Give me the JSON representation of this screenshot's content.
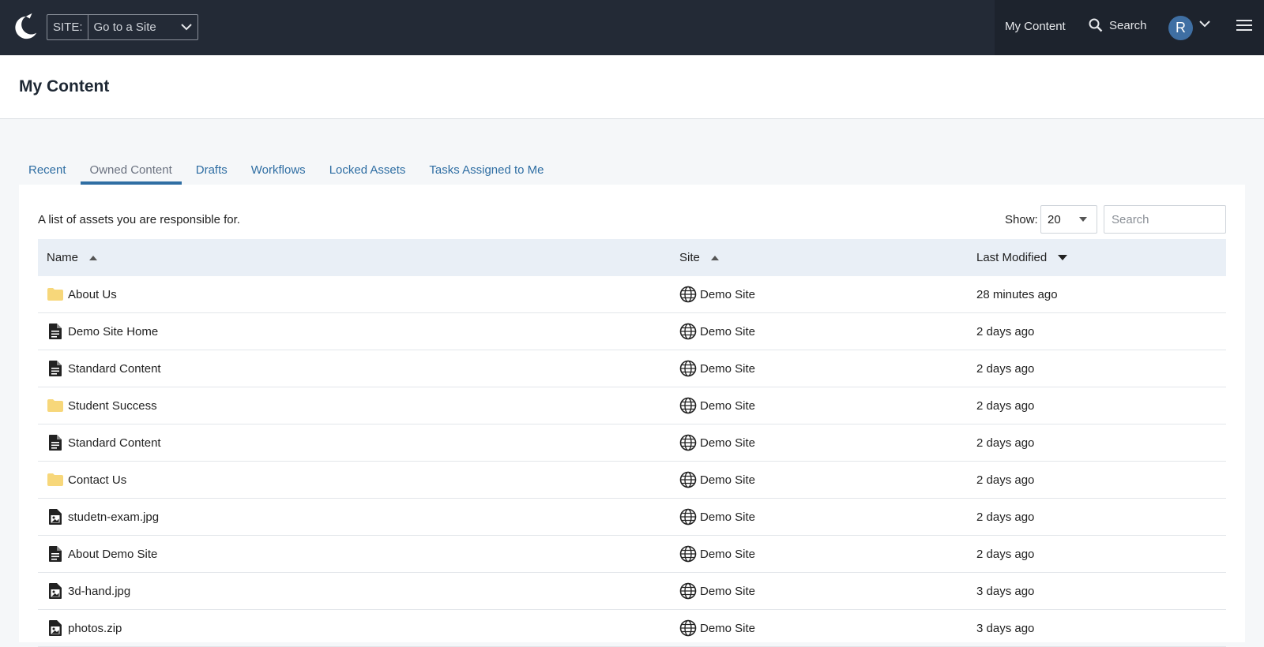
{
  "topbar": {
    "site_label": "SITE:",
    "site_value": "Go to a Site",
    "my_content": "My Content",
    "search": "Search",
    "avatar_initial": "R"
  },
  "page": {
    "title": "My Content"
  },
  "tabs": [
    {
      "label": "Recent",
      "active": false
    },
    {
      "label": "Owned Content",
      "active": true
    },
    {
      "label": "Drafts",
      "active": false
    },
    {
      "label": "Workflows",
      "active": false
    },
    {
      "label": "Locked Assets",
      "active": false
    },
    {
      "label": "Tasks Assigned to Me",
      "active": false
    }
  ],
  "panel": {
    "description": "A list of assets you are responsible for.",
    "show_label": "Show:",
    "show_value": "20",
    "search_placeholder": "Search"
  },
  "table": {
    "headers": {
      "name": "Name",
      "site": "Site",
      "modified": "Last Modified"
    },
    "rows": [
      {
        "type": "folder-icon",
        "name": "About Us",
        "site": "Demo Site",
        "modified": "28 minutes ago"
      },
      {
        "type": "page-icon",
        "name": "Demo Site Home",
        "site": "Demo Site",
        "modified": "2 days ago"
      },
      {
        "type": "page-icon",
        "name": "Standard Content",
        "site": "Demo Site",
        "modified": "2 days ago"
      },
      {
        "type": "folder-icon",
        "name": "Student Success",
        "site": "Demo Site",
        "modified": "2 days ago"
      },
      {
        "type": "page-icon",
        "name": "Standard Content",
        "site": "Demo Site",
        "modified": "2 days ago"
      },
      {
        "type": "folder-icon",
        "name": "Contact Us",
        "site": "Demo Site",
        "modified": "2 days ago"
      },
      {
        "type": "image-file-icon",
        "name": "studetn-exam.jpg",
        "site": "Demo Site",
        "modified": "2 days ago"
      },
      {
        "type": "page-icon",
        "name": "About Demo Site",
        "site": "Demo Site",
        "modified": "2 days ago"
      },
      {
        "type": "image-file-icon",
        "name": "3d-hand.jpg",
        "site": "Demo Site",
        "modified": "3 days ago"
      },
      {
        "type": "image-file-icon",
        "name": "photos.zip",
        "site": "Demo Site",
        "modified": "3 days ago"
      }
    ]
  },
  "colors": {
    "topbar": "#232a36",
    "accent": "#2f6ea3",
    "header_row": "#e9eff6",
    "folder": "#f7d77a"
  }
}
